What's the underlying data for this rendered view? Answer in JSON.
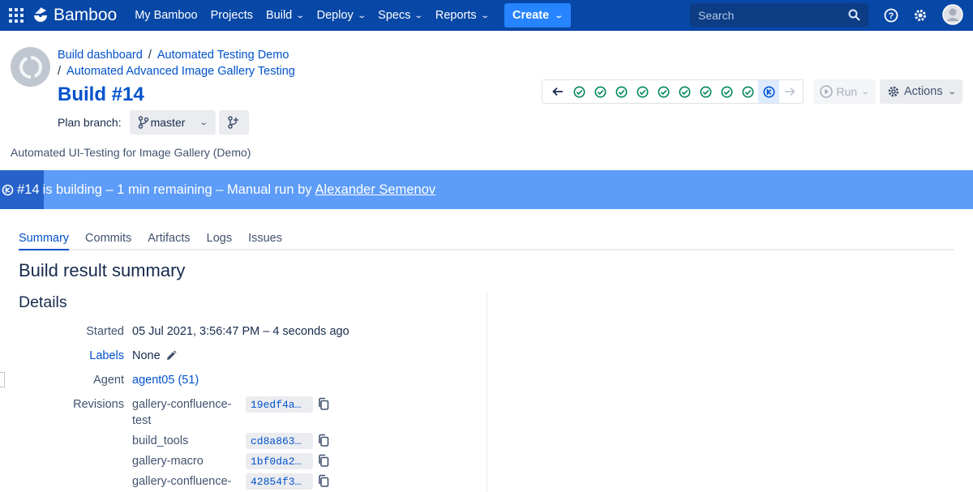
{
  "nav": {
    "app_name": "Bamboo",
    "items": [
      {
        "label": "My Bamboo",
        "dropdown": false
      },
      {
        "label": "Projects",
        "dropdown": false
      },
      {
        "label": "Build",
        "dropdown": true
      },
      {
        "label": "Deploy",
        "dropdown": true
      },
      {
        "label": "Specs",
        "dropdown": true
      },
      {
        "label": "Reports",
        "dropdown": true
      }
    ],
    "create_label": "Create",
    "search_placeholder": "Search",
    "colors": {
      "bar": "#0747a6",
      "create": "#2684ff"
    }
  },
  "header": {
    "breadcrumb": [
      "Build dashboard",
      "Automated Testing Demo",
      "Automated Advanced Image Gallery Testing"
    ],
    "title": "Build #14",
    "plan_branch_label": "Plan branch:",
    "branch": "master",
    "description": "Automated UI-Testing for Image Gallery (Demo)",
    "history": [
      "success",
      "success",
      "success",
      "success",
      "success",
      "success",
      "success",
      "success",
      "success",
      "building"
    ],
    "run_label": "Run",
    "actions_label": "Actions"
  },
  "status": {
    "build_number": "#14",
    "text": "is building – 1 min remaining – Manual run by",
    "user": "Alexander Semenov",
    "progress_fraction": 0.045,
    "color": "#5d9cf8"
  },
  "tabs": [
    "Summary",
    "Commits",
    "Artifacts",
    "Logs",
    "Issues"
  ],
  "active_tab": "Summary",
  "summary": {
    "heading": "Build result summary",
    "details_heading": "Details",
    "started_label": "Started",
    "started_value": "05 Jul 2021, 3:56:47 PM – 4 seconds ago",
    "labels_label": "Labels",
    "labels_value": "None",
    "agent_label": "Agent",
    "agent_value": "agent05 (51)",
    "revisions_label": "Revisions",
    "revisions": [
      {
        "repo": "gallery-confluence-test",
        "hash": "19edf4a…"
      },
      {
        "repo": "build_tools",
        "hash": "cd8a863…"
      },
      {
        "repo": "gallery-macro",
        "hash": "1bf0da2…"
      },
      {
        "repo": "gallery-confluence-",
        "hash": "42854f3…"
      }
    ]
  }
}
